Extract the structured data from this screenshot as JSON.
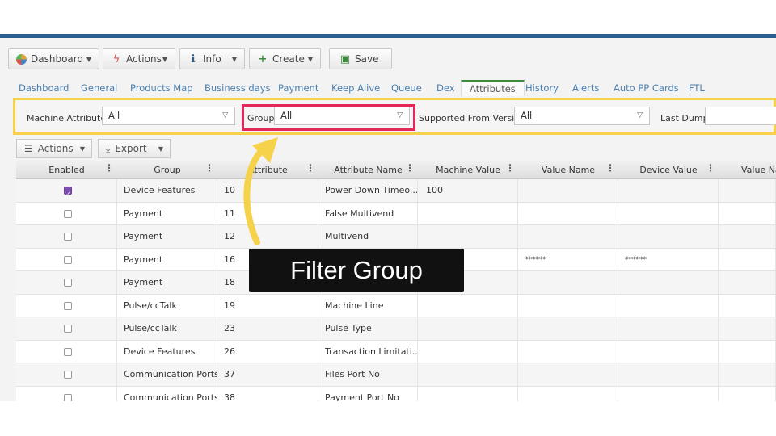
{
  "toolbar": {
    "dashboard": "Dashboard",
    "actions": "Actions",
    "info": "Info",
    "create": "Create",
    "save": "Save"
  },
  "tabs": [
    "Dashboard",
    "General",
    "Products Map",
    "Business days",
    "Payment",
    "Keep Alive",
    "Queue",
    "Dex",
    "Attributes",
    "History",
    "Alerts",
    "Auto PP Cards",
    "FTL"
  ],
  "active_tab": "Attributes",
  "filters": {
    "machine_attributes_label": "Machine Attributes",
    "machine_attributes_value": "All",
    "group_label": "Group",
    "group_value": "All",
    "supported_label": "Supported From Version",
    "supported_value": "All",
    "last_dump_label": "Last Dump:",
    "last_dump_value": ""
  },
  "grid_tools": {
    "actions": "Actions",
    "export": "Export"
  },
  "columns": [
    "Enabled",
    "Group",
    "Attribute",
    "Attribute Name",
    "Machine Value",
    "Value Name",
    "Device Value",
    "Value Na"
  ],
  "rows": [
    {
      "enabled": true,
      "group": "Device Features",
      "attr": "10",
      "name": "Power Down Timeo...",
      "mvalue": "100",
      "vname": "",
      "dvalue": ""
    },
    {
      "enabled": false,
      "group": "Payment",
      "attr": "11",
      "name": "False Multivend",
      "mvalue": "",
      "vname": "",
      "dvalue": ""
    },
    {
      "enabled": false,
      "group": "Payment",
      "attr": "12",
      "name": "Multivend",
      "mvalue": "",
      "vname": "",
      "dvalue": ""
    },
    {
      "enabled": false,
      "group": "Payment",
      "attr": "16",
      "name": "",
      "mvalue": "",
      "vname": "******",
      "dvalue": "******"
    },
    {
      "enabled": false,
      "group": "Payment",
      "attr": "18",
      "name": "",
      "mvalue": "",
      "vname": "",
      "dvalue": ""
    },
    {
      "enabled": false,
      "group": "Pulse/ccTalk",
      "attr": "19",
      "name": "Machine Line",
      "mvalue": "",
      "vname": "",
      "dvalue": ""
    },
    {
      "enabled": false,
      "group": "Pulse/ccTalk",
      "attr": "23",
      "name": "Pulse Type",
      "mvalue": "",
      "vname": "",
      "dvalue": ""
    },
    {
      "enabled": false,
      "group": "Device Features",
      "attr": "26",
      "name": "Transaction Limitati...",
      "mvalue": "",
      "vname": "",
      "dvalue": ""
    },
    {
      "enabled": false,
      "group": "Communication Ports",
      "attr": "37",
      "name": "Files Port No",
      "mvalue": "",
      "vname": "",
      "dvalue": ""
    },
    {
      "enabled": false,
      "group": "Communication Ports",
      "attr": "38",
      "name": "Payment Port No",
      "mvalue": "",
      "vname": "",
      "dvalue": ""
    }
  ],
  "callout": "Filter Group",
  "colors": {
    "highlight_panel": "#f6d24b",
    "highlight_group": "#e4295a",
    "arrow": "#f6d24b",
    "active_tab_bar": "#3c8b3c"
  }
}
